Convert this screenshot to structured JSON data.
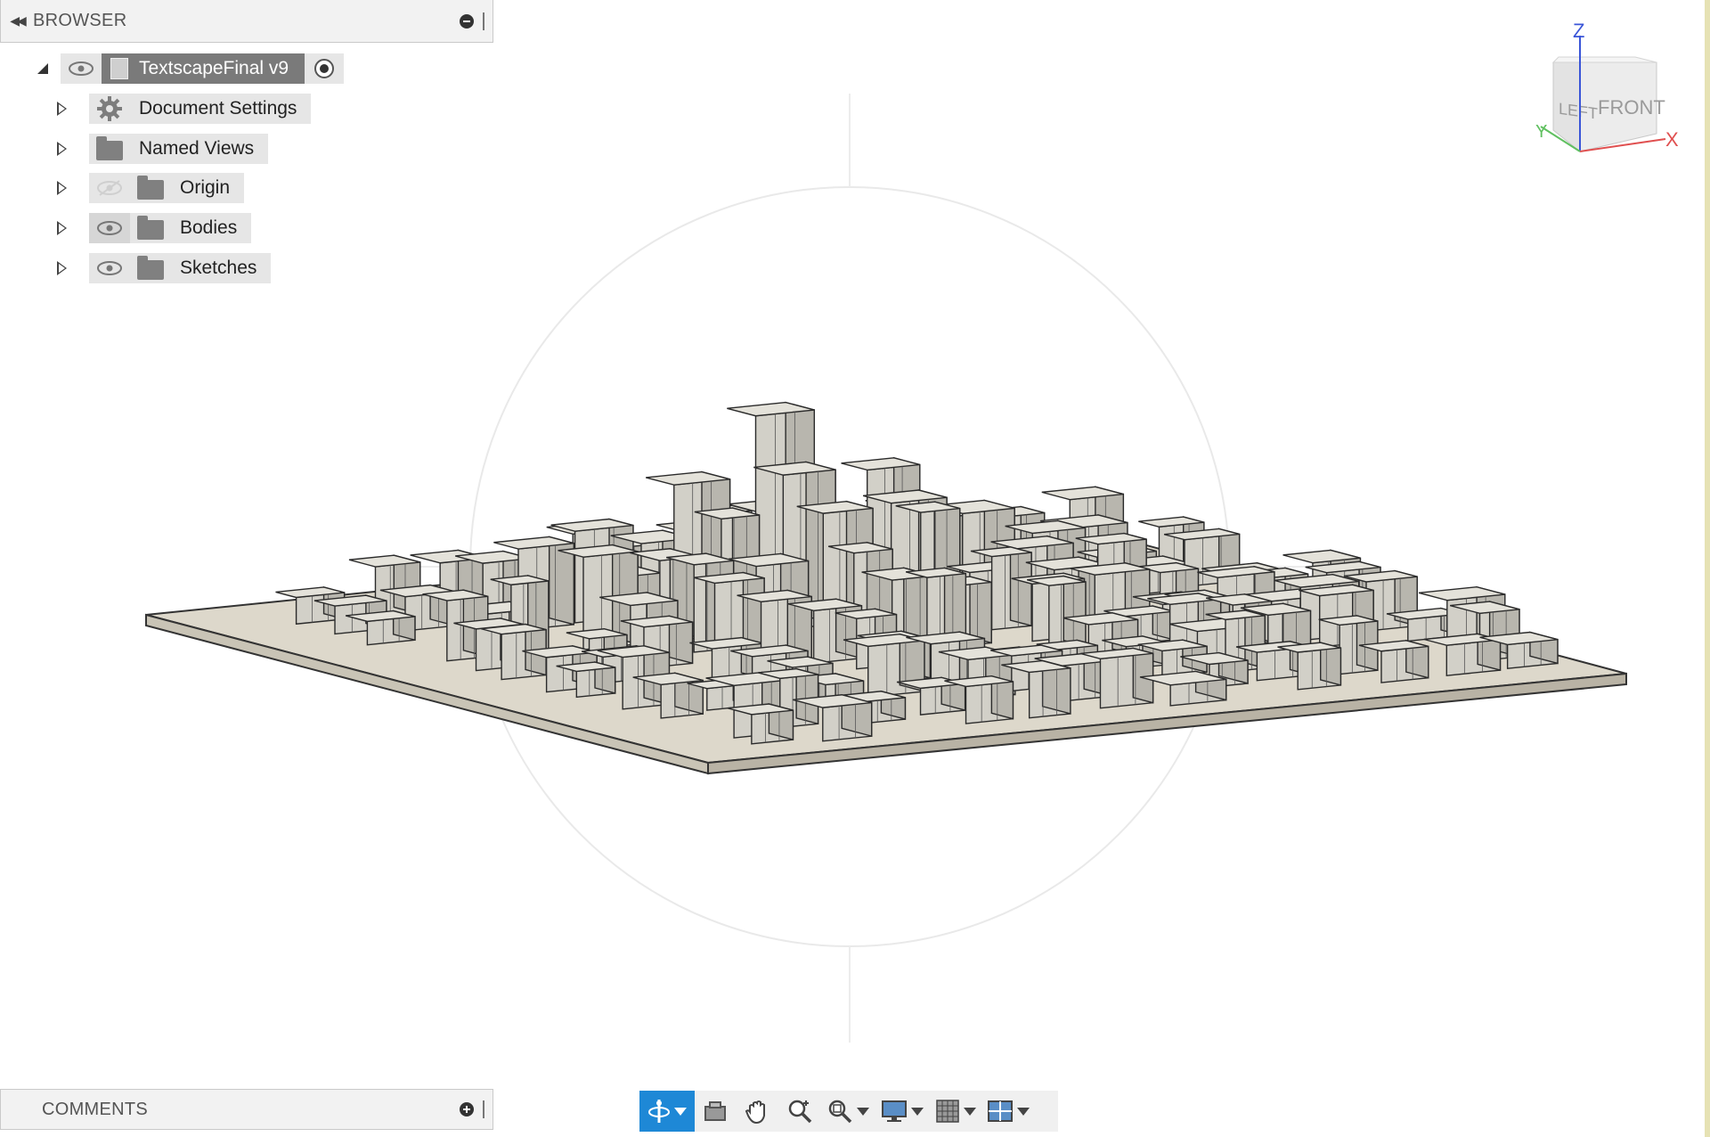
{
  "browser": {
    "title": "BROWSER",
    "root": {
      "label": "TextscapeFinal v9"
    },
    "items": [
      {
        "label": "Document Settings",
        "icon": "gear-icon",
        "visibility": "none"
      },
      {
        "label": "Named Views",
        "icon": "folder-icon",
        "visibility": "none"
      },
      {
        "label": "Origin",
        "icon": "folder-icon",
        "visibility": "hidden"
      },
      {
        "label": "Bodies",
        "icon": "folder-icon",
        "visibility": "visible"
      },
      {
        "label": "Sketches",
        "icon": "folder-icon",
        "visibility": "visible"
      }
    ]
  },
  "comments": {
    "title": "COMMENTS"
  },
  "viewcube": {
    "faces": [
      "LEFT",
      "FRONT"
    ],
    "axes": [
      "Z",
      "X",
      "Y"
    ]
  },
  "toolbar": {
    "tools": [
      "orbit-icon",
      "look-at-icon",
      "pan-icon",
      "zoom-icon",
      "fit-icon",
      "display-settings-icon",
      "grid-settings-icon",
      "viewports-icon"
    ]
  },
  "colors": {
    "accent": "#1e88d6",
    "base_plate": "#ddd8cb",
    "buildings": "#d6d4cc"
  }
}
